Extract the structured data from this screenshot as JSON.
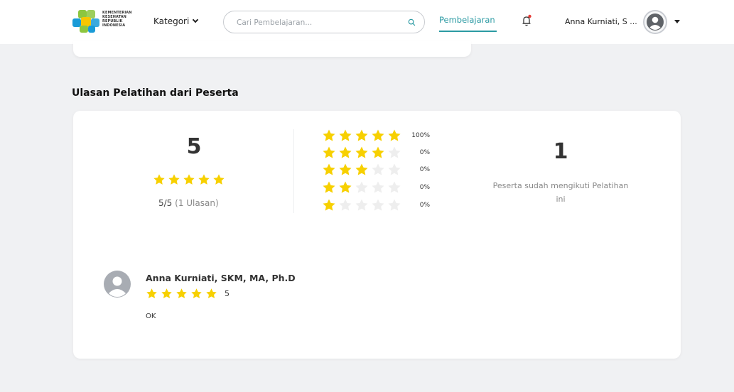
{
  "header": {
    "logo_lines": [
      "KEMENTERIAN",
      "KESEHATAN",
      "REPUBLIK",
      "INDONESIA"
    ],
    "kategori_label": "Kategori",
    "search_placeholder": "Cari Pembelajaran...",
    "nav_pembelajaran": "Pembelajaran",
    "user_name": "Anna Kurniati, S ...",
    "brand_colors": {
      "teal": "#2b9aa3",
      "yellow": "#f7c600",
      "green": "#8dc63f",
      "blue": "#1a9bd7"
    }
  },
  "section": {
    "title": "Ulasan Pelatihan dari Peserta"
  },
  "rating": {
    "average": "5",
    "average_stars": 5,
    "summary_main": "5/5",
    "summary_sub": "(1 Ulasan)",
    "distribution": [
      {
        "stars": 5,
        "percent": "100%"
      },
      {
        "stars": 4,
        "percent": "0%"
      },
      {
        "stars": 3,
        "percent": "0%"
      },
      {
        "stars": 2,
        "percent": "0%"
      },
      {
        "stars": 1,
        "percent": "0%"
      }
    ],
    "participants_count": "1",
    "participants_label": "Peserta sudah mengikuti Pelatihan ini",
    "star_color": "#f7d000",
    "star_empty_color": "#eeeeee"
  },
  "reviews": [
    {
      "name": "Anna Kurniati, SKM, MA, Ph.D",
      "stars": 5,
      "score": "5",
      "comment": "OK"
    }
  ]
}
